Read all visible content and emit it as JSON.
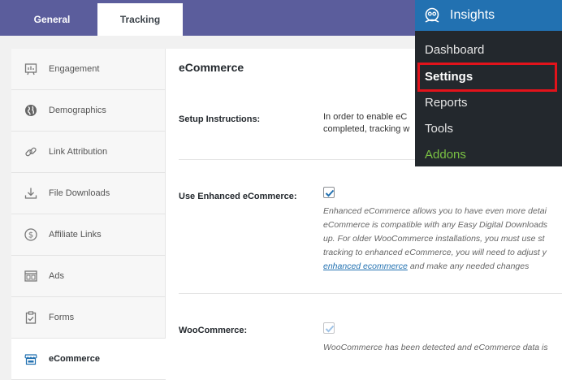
{
  "tabs": [
    {
      "label": "General"
    },
    {
      "label": "Tracking"
    }
  ],
  "sidebar": {
    "items": [
      {
        "label": "Engagement",
        "icon": "engagement-icon"
      },
      {
        "label": "Demographics",
        "icon": "globe-icon"
      },
      {
        "label": "Link Attribution",
        "icon": "link-icon"
      },
      {
        "label": "File Downloads",
        "icon": "download-icon"
      },
      {
        "label": "Affiliate Links",
        "icon": "dollar-icon"
      },
      {
        "label": "Ads",
        "icon": "ads-icon"
      },
      {
        "label": "Forms",
        "icon": "clipboard-icon"
      },
      {
        "label": "eCommerce",
        "icon": "store-icon"
      }
    ]
  },
  "main": {
    "title": "eCommerce",
    "setup_label": "Setup Instructions:",
    "setup_text_1": "In order to enable eC",
    "setup_text_2": "completed, tracking w",
    "enhanced_label": "Use Enhanced eCommerce:",
    "enhanced_checked": true,
    "enhanced_desc": [
      "Enhanced eCommerce allows you to have even more detai",
      "eCommerce is compatible with any Easy Digital Downloads",
      "up. For older WooCommerce installations, you must use st",
      "tracking to enhanced eCommerce, you will need to adjust y"
    ],
    "enhanced_link": "enhanced ecommerce",
    "enhanced_link_suffix": " and make any needed changes",
    "woo_label": "WooCommerce:",
    "woo_checked": true,
    "woo_desc": "WooCommerce has been detected and eCommerce data is"
  },
  "menu": {
    "title": "Insights",
    "items": [
      {
        "label": "Dashboard"
      },
      {
        "label": "Settings"
      },
      {
        "label": "Reports"
      },
      {
        "label": "Tools"
      },
      {
        "label": "Addons"
      }
    ]
  },
  "colors": {
    "tabbar": "#5b5d9c",
    "menu_bg": "#23282d",
    "menu_header": "#2271b1",
    "highlight": "#e2131b",
    "addons": "#7ac143",
    "link": "#2271b1"
  }
}
